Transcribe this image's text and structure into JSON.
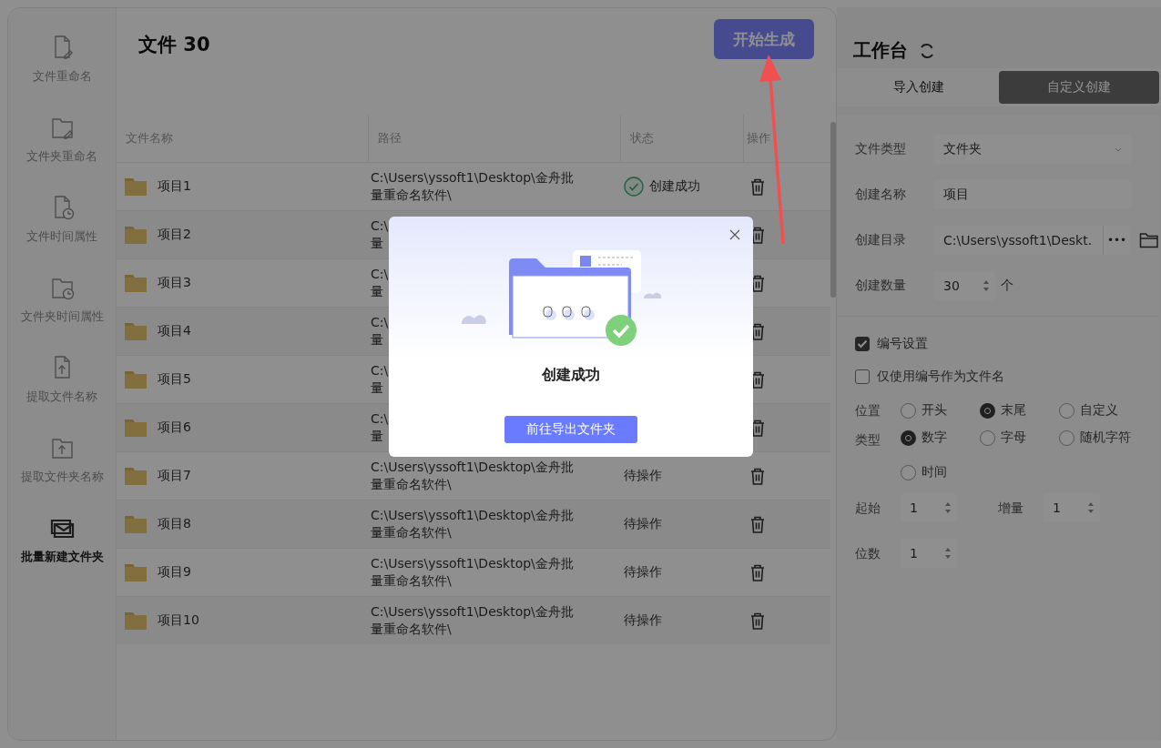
{
  "sidebar": {
    "items": [
      {
        "label": "文件重命名",
        "selected": false
      },
      {
        "label": "文件夹重命名",
        "selected": false
      },
      {
        "label": "文件时间属性",
        "selected": false
      },
      {
        "label": "文件夹时间属性",
        "selected": false
      },
      {
        "label": "提取文件名称",
        "selected": false
      },
      {
        "label": "提取文件夹名称",
        "selected": false
      },
      {
        "label": "批量新建文件夹",
        "selected": true
      }
    ]
  },
  "header": {
    "title": "文件 30",
    "start_button": "开始生成"
  },
  "table": {
    "columns": [
      "文件名称",
      "路径",
      "状态",
      "操作"
    ],
    "rows": [
      {
        "name": "项目1",
        "path": [
          "C:\\Users\\yssoft1\\Desktop\\金舟批",
          "量重命名软件\\"
        ],
        "status": {
          "kind": "success",
          "label": "创建成功"
        }
      },
      {
        "name": "项目2",
        "path": [
          "C:\\",
          "量"
        ]
      },
      {
        "name": "项目3",
        "path": [
          "C:\\",
          "量"
        ]
      },
      {
        "name": "项目4",
        "path": [
          "C:\\",
          "量"
        ]
      },
      {
        "name": "项目5",
        "path": [
          "C:\\",
          "量"
        ]
      },
      {
        "name": "项目6",
        "path": [
          "C:\\",
          "量"
        ]
      },
      {
        "name": "项目7",
        "path": [
          "C:\\Users\\yssoft1\\Desktop\\金舟批",
          "量重命名软件\\"
        ],
        "status": {
          "kind": "pending",
          "label": "待操作"
        }
      },
      {
        "name": "项目8",
        "path": [
          "C:\\Users\\yssoft1\\Desktop\\金舟批",
          "量重命名软件\\"
        ],
        "status": {
          "kind": "pending",
          "label": "待操作"
        }
      },
      {
        "name": "项目9",
        "path": [
          "C:\\Users\\yssoft1\\Desktop\\金舟批",
          "量重命名软件\\"
        ],
        "status": {
          "kind": "pending",
          "label": "待操作"
        }
      },
      {
        "name": "项目10",
        "path": [
          "C:\\Users\\yssoft1\\Desktop\\金舟批",
          "量重命名软件\\"
        ],
        "status": {
          "kind": "pending",
          "label": "待操作"
        }
      }
    ]
  },
  "workbench": {
    "title": "工作台",
    "tabs": [
      {
        "label": "导入创建",
        "selected": false
      },
      {
        "label": "自定义创建",
        "selected": true
      }
    ],
    "fields": [
      {
        "kind": "select",
        "label": "文件类型",
        "value": "文件夹"
      },
      {
        "kind": "text",
        "label": "创建名称",
        "value": "项目"
      },
      {
        "kind": "path",
        "label": "创建目录",
        "value": "C:\\Users\\yssoft1\\Deskt.",
        "button": "•••"
      },
      {
        "kind": "number",
        "label": "创建数量",
        "value": "30",
        "unit": "个"
      }
    ],
    "checkboxes": [
      {
        "label": "编号设置",
        "checked": true
      },
      {
        "label": "仅使用编号作为文件名",
        "checked": false
      }
    ],
    "radio_groups": [
      {
        "label": "位置",
        "options": [
          {
            "label": "开头",
            "selected": false
          },
          {
            "label": "末尾",
            "selected": true
          },
          {
            "label": "自定义",
            "selected": false
          }
        ]
      },
      {
        "label": "类型",
        "options": [
          {
            "label": "数字",
            "selected": true
          },
          {
            "label": "字母",
            "selected": false
          },
          {
            "label": "随机字符",
            "selected": false
          },
          {
            "label": "时间",
            "selected": false
          }
        ]
      }
    ],
    "spinners": [
      {
        "label": "起始",
        "value": "1"
      },
      {
        "label": "增量",
        "value": "1"
      },
      {
        "label": "位数",
        "value": "1"
      }
    ]
  },
  "dialog": {
    "title": "创建成功",
    "button": "前往导出文件夹"
  }
}
